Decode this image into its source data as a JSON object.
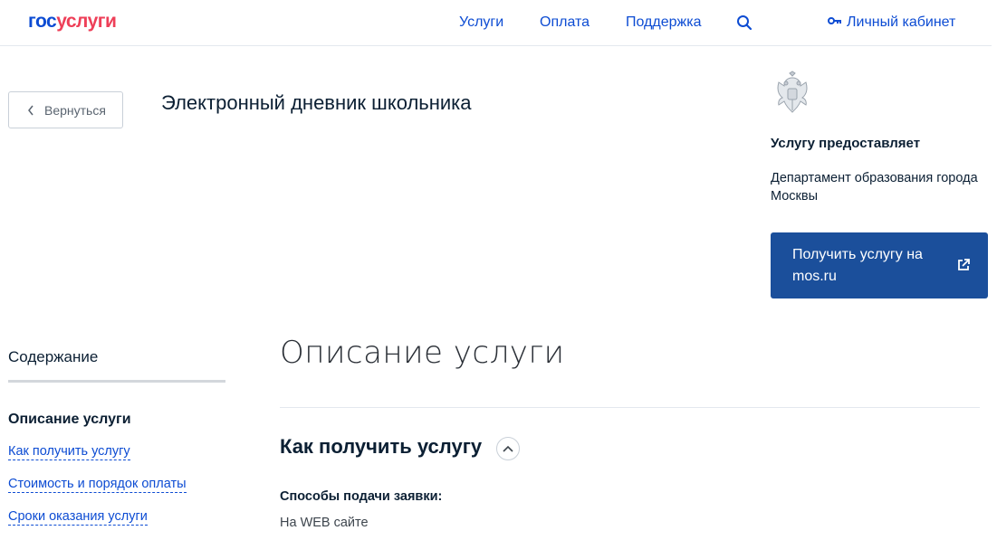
{
  "header": {
    "logo_part1": "гос",
    "logo_part2": "услуги",
    "nav": [
      "Услуги",
      "Оплата",
      "Поддержка"
    ],
    "cabinet_label": "Личный кабинет",
    "search_icon": "search-icon",
    "cabinet_icon": "key-icon"
  },
  "back_button": {
    "label": "Вернуться",
    "icon": "chevron-left-icon"
  },
  "page_title": "Электронный дневник школьника",
  "provider": {
    "emblem": "coat-of-arms-icon",
    "heading": "Услугу предоставляет",
    "name": "Департамент образования города Москвы",
    "button_label": "Получить услугу на mos.ru",
    "button_icon": "external-link-icon"
  },
  "sidebar": {
    "title": "Содержание",
    "active_item": "Описание услуги",
    "links": [
      "Как получить услугу",
      "Стоимость и порядок оплаты",
      "Сроки оказания услуги"
    ]
  },
  "main": {
    "section_title": "Описание услуги",
    "subsection_title": "Как получить услугу",
    "collapse_icon": "chevron-up-icon",
    "methods_label": "Способы подачи заявки:",
    "methods": [
      "На WEB сайте"
    ]
  },
  "colors": {
    "link_blue": "#0d4cd3",
    "logo_red": "#ee3f58",
    "button_bg": "#1b4f9b",
    "text_dark": "#0b1f33"
  }
}
